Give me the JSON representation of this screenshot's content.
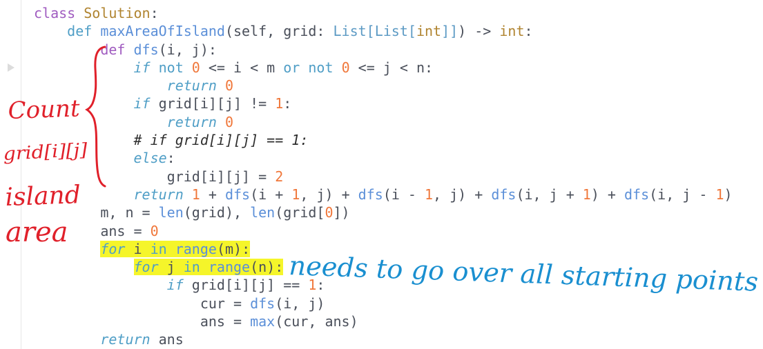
{
  "code": {
    "lines": [
      [
        [
          "kw",
          "class "
        ],
        [
          "cls",
          "Solution"
        ],
        [
          "id",
          ":"
        ]
      ],
      [
        [
          "sp",
          "    "
        ],
        [
          "kw2",
          "def "
        ],
        [
          "fn",
          "maxAreaOfIsland"
        ],
        [
          "id",
          "(self, grid: "
        ],
        [
          "ann",
          "List[List["
        ],
        [
          "ty",
          "int"
        ],
        [
          "ann",
          "]]"
        ],
        [
          "id",
          ") -> "
        ],
        [
          "ty",
          "int"
        ],
        [
          "id",
          ":"
        ]
      ],
      [
        [
          "sp",
          "        "
        ],
        [
          "kw",
          "def "
        ],
        [
          "fn",
          "dfs"
        ],
        [
          "id",
          "(i, j):"
        ]
      ],
      [
        [
          "sp",
          "            "
        ],
        [
          "it",
          "if "
        ],
        [
          "kw2",
          "not "
        ],
        [
          "num",
          "0"
        ],
        [
          "id",
          " <= i < m "
        ],
        [
          "kw2",
          "or not "
        ],
        [
          "num",
          "0"
        ],
        [
          "id",
          " <= j < n:"
        ]
      ],
      [
        [
          "sp",
          "                "
        ],
        [
          "it",
          "return "
        ],
        [
          "num",
          "0"
        ]
      ],
      [
        [
          "sp",
          "            "
        ],
        [
          "it",
          "if "
        ],
        [
          "id",
          "grid[i][j] != "
        ],
        [
          "num",
          "1"
        ],
        [
          "id",
          ":"
        ]
      ],
      [
        [
          "sp",
          "                "
        ],
        [
          "it",
          "return "
        ],
        [
          "num",
          "0"
        ]
      ],
      [
        [
          "sp",
          "            "
        ],
        [
          "cm",
          "# if grid[i][j] == 1:"
        ]
      ],
      [
        [
          "sp",
          "            "
        ],
        [
          "it",
          "else"
        ],
        [
          "id",
          ":"
        ]
      ],
      [
        [
          "sp",
          "                "
        ],
        [
          "id",
          "grid[i][j] = "
        ],
        [
          "num",
          "2"
        ]
      ],
      [
        [
          "sp",
          "            "
        ],
        [
          "it",
          "return "
        ],
        [
          "num",
          "1"
        ],
        [
          "id",
          " + "
        ],
        [
          "fn",
          "dfs"
        ],
        [
          "id",
          "(i + "
        ],
        [
          "num",
          "1"
        ],
        [
          "id",
          ", j) + "
        ],
        [
          "fn",
          "dfs"
        ],
        [
          "id",
          "(i - "
        ],
        [
          "num",
          "1"
        ],
        [
          "id",
          ", j) + "
        ],
        [
          "fn",
          "dfs"
        ],
        [
          "id",
          "(i, j + "
        ],
        [
          "num",
          "1"
        ],
        [
          "id",
          ") + "
        ],
        [
          "fn",
          "dfs"
        ],
        [
          "id",
          "(i, j - "
        ],
        [
          "num",
          "1"
        ],
        [
          "id",
          ")"
        ]
      ],
      [
        [
          "sp",
          "        "
        ],
        [
          "id",
          "m, n = "
        ],
        [
          "fn",
          "len"
        ],
        [
          "id",
          "(grid), "
        ],
        [
          "fn",
          "len"
        ],
        [
          "id",
          "(grid["
        ],
        [
          "num",
          "0"
        ],
        [
          "id",
          "])"
        ]
      ],
      [
        [
          "sp",
          "        "
        ],
        [
          "id",
          "ans = "
        ],
        [
          "num",
          "0"
        ]
      ],
      [
        [
          "sp",
          "        "
        ],
        [
          "hl-it",
          "for "
        ],
        [
          "hl",
          "i "
        ],
        [
          "hl-kw",
          "in "
        ],
        [
          "hl-fn",
          "range"
        ],
        [
          "hl",
          "(m)"
        ],
        [
          "hl",
          ":"
        ]
      ],
      [
        [
          "sp",
          "            "
        ],
        [
          "hl-it",
          "for "
        ],
        [
          "hl",
          "j "
        ],
        [
          "hl-kw",
          "in "
        ],
        [
          "hl-fn",
          "range"
        ],
        [
          "hl",
          "(n)"
        ],
        [
          "hl",
          ":"
        ]
      ],
      [
        [
          "sp",
          "                "
        ],
        [
          "it",
          "if "
        ],
        [
          "id",
          "grid[i][j] == "
        ],
        [
          "num",
          "1"
        ],
        [
          "id",
          ":"
        ]
      ],
      [
        [
          "sp",
          "                    "
        ],
        [
          "id",
          "cur = "
        ],
        [
          "fn",
          "dfs"
        ],
        [
          "id",
          "(i, j)"
        ]
      ],
      [
        [
          "sp",
          "                    "
        ],
        [
          "id",
          "ans = "
        ],
        [
          "fn",
          "max"
        ],
        [
          "id",
          "(cur, ans)"
        ]
      ],
      [
        [
          "sp",
          "        "
        ],
        [
          "it",
          "return "
        ],
        [
          "id",
          "ans"
        ]
      ]
    ]
  },
  "annotations": {
    "red_note_lines": [
      "Count",
      "grid[i][j]",
      "island",
      "area"
    ],
    "blue_note": "needs to go over all starting points",
    "red_color": "#e0202a",
    "blue_color": "#1a8fd0"
  }
}
